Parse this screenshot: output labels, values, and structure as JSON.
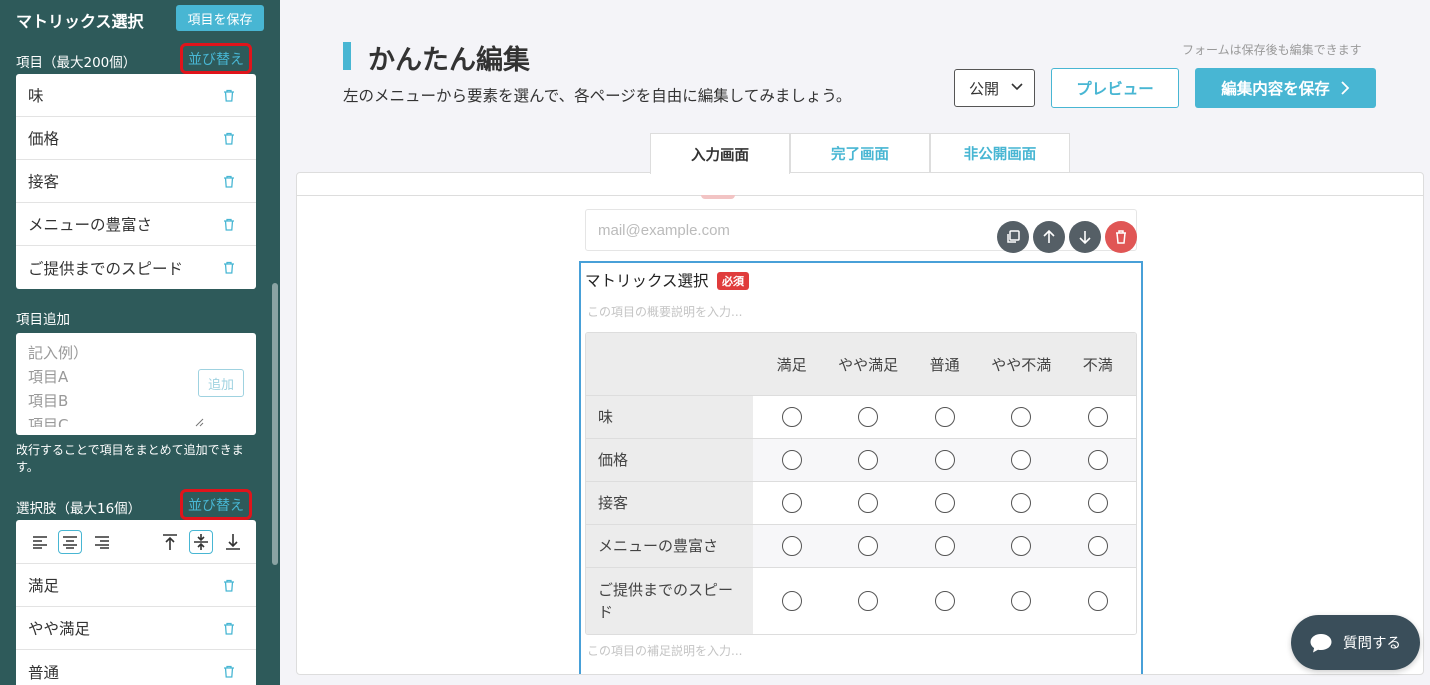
{
  "sidebar": {
    "title": "マトリックス選択",
    "save_button": "項目を保存",
    "items_label": "項目（最大200個）",
    "sort_label": "並び替え",
    "items": [
      "味",
      "価格",
      "接客",
      "メニューの豊富さ",
      "ご提供までのスピード"
    ],
    "add_label": "項目追加",
    "add_placeholder": "記入例）\n項目A\n項目B\n項目C",
    "add_button": "追加",
    "add_note": "改行することで項目をまとめて追加できます。",
    "options_label": "選択肢（最大16個）",
    "options": [
      "満足",
      "やや満足",
      "普通"
    ]
  },
  "header": {
    "title": "かんたん編集",
    "subtitle": "左のメニューから要素を選んで、各ページを自由に編集してみましょう。",
    "note": "フォームは保存後も編集できます",
    "visibility": "公開",
    "preview": "プレビュー",
    "save": "編集内容を保存"
  },
  "tabs": [
    "入力画面",
    "完了画面",
    "非公開画面"
  ],
  "form": {
    "email_placeholder": "mail@example.com",
    "field_title": "マトリックス選択",
    "required_badge": "必須",
    "description_placeholder": "この項目の概要説明を入力...",
    "supplement_placeholder": "この項目の補足説明を入力...",
    "columns": [
      "満足",
      "やや満足",
      "普通",
      "やや不満",
      "不満"
    ],
    "rows": [
      "味",
      "価格",
      "接客",
      "メニューの豊富さ",
      "ご提供までのスピード"
    ]
  },
  "chat": {
    "label": "質問する"
  },
  "colors": {
    "accent": "#48b6d3",
    "sidebar": "#2e5a5a",
    "danger": "#e05655",
    "highlight": "#e0141b"
  }
}
